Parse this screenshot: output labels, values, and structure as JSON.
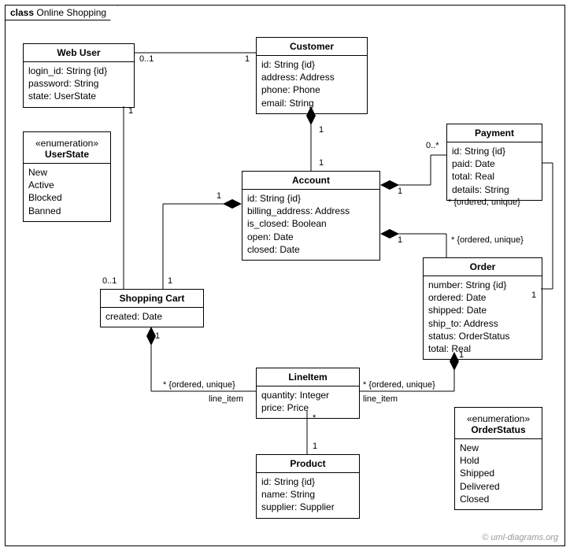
{
  "frame": {
    "keyword": "class",
    "title": "Online Shopping"
  },
  "classes": {
    "WebUser": {
      "name": "Web User",
      "attrs": [
        "login_id: String {id}",
        "password: String",
        "state: UserState"
      ]
    },
    "UserState": {
      "stereotype": "«enumeration»",
      "name": "UserState",
      "vals": [
        "New",
        "Active",
        "Blocked",
        "Banned"
      ]
    },
    "Customer": {
      "name": "Customer",
      "attrs": [
        "id: String {id}",
        "address: Address",
        "phone: Phone",
        "email: String"
      ]
    },
    "Account": {
      "name": "Account",
      "attrs": [
        "id: String {id}",
        "billing_address: Address",
        "is_closed: Boolean",
        "open: Date",
        "closed: Date"
      ]
    },
    "Payment": {
      "name": "Payment",
      "attrs": [
        "id: String {id}",
        "paid: Date",
        "total: Real",
        "details: String"
      ]
    },
    "Order": {
      "name": "Order",
      "attrs": [
        "number: String {id}",
        "ordered: Date",
        "shipped: Date",
        "ship_to: Address",
        "status: OrderStatus",
        "total: Real"
      ]
    },
    "ShoppingCart": {
      "name": "Shopping Cart",
      "attrs": [
        "created: Date"
      ]
    },
    "LineItem": {
      "name": "LineItem",
      "attrs": [
        "quantity: Integer",
        "price: Price"
      ]
    },
    "Product": {
      "name": "Product",
      "attrs": [
        "id: String {id}",
        "name: String",
        "supplier: Supplier"
      ]
    },
    "OrderStatus": {
      "stereotype": "«enumeration»",
      "name": "OrderStatus",
      "vals": [
        "New",
        "Hold",
        "Shipped",
        "Delivered",
        "Closed"
      ]
    }
  },
  "labels": {
    "wu_cust_left": "0..1",
    "wu_cust_right": "1",
    "wu_cart_top": "1",
    "wu_cart_bot": "0..1",
    "cust_acct_top": "1",
    "cust_acct_bot": "1",
    "acct_cart_left": "1",
    "acct_cart_right": "1",
    "acct_pay_left": "1",
    "acct_pay_right": "0..*",
    "acct_order_left": "1",
    "acct_order_right": "* {ordered, unique}",
    "order_pay_bot": "1",
    "order_pay_top": "* {ordered, unique}",
    "cart_line_top": "1",
    "cart_line_bot": "* {ordered, unique}",
    "cart_line_role": "line_item",
    "order_line_top": "1",
    "order_line_bot": "* {ordered, unique}",
    "order_line_role": "line_item",
    "line_prod_top": "*",
    "line_prod_bot": "1"
  },
  "credit": "© uml-diagrams.org"
}
